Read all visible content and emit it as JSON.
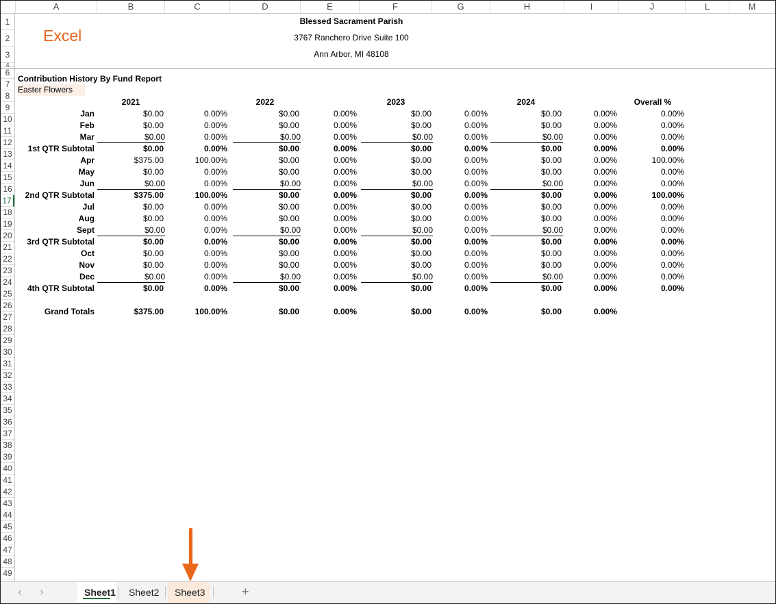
{
  "columns": [
    "A",
    "B",
    "C",
    "D",
    "E",
    "F",
    "G",
    "H",
    "I",
    "J",
    "L",
    "M"
  ],
  "rows": [
    "1",
    "2",
    "3",
    "4",
    "6",
    "7",
    "8",
    "9",
    "10",
    "11",
    "12",
    "13",
    "14",
    "15",
    "16",
    "17",
    "18",
    "19",
    "20",
    "21",
    "22",
    "23",
    "24",
    "25",
    "26",
    "27",
    "28",
    "29",
    "30",
    "31",
    "32",
    "33",
    "34",
    "35",
    "36",
    "37",
    "38",
    "39",
    "40",
    "41",
    "42",
    "43",
    "44",
    "45",
    "46",
    "47",
    "48",
    "49"
  ],
  "logo_text": "Excel",
  "header": {
    "parish": "Blessed Sacrament Parish",
    "address1": "3767 Ranchero Drive Suite 100",
    "address2": "Ann Arbor, MI 48108"
  },
  "report": {
    "title": "Contribution History By Fund Report",
    "fund": "Easter Flowers"
  },
  "years": [
    "2021",
    "2022",
    "2023",
    "2024"
  ],
  "overall_label": "Overall %",
  "table": [
    {
      "label": "Jan",
      "bold": false,
      "ul": false,
      "vals": [
        "$0.00",
        "0.00%",
        "$0.00",
        "0.00%",
        "$0.00",
        "0.00%",
        "$0.00",
        "0.00%",
        "0.00%"
      ]
    },
    {
      "label": "Feb",
      "bold": false,
      "ul": false,
      "vals": [
        "$0.00",
        "0.00%",
        "$0.00",
        "0.00%",
        "$0.00",
        "0.00%",
        "$0.00",
        "0.00%",
        "0.00%"
      ]
    },
    {
      "label": "Mar",
      "bold": false,
      "ul": true,
      "vals": [
        "$0.00",
        "0.00%",
        "$0.00",
        "0.00%",
        "$0.00",
        "0.00%",
        "$0.00",
        "0.00%",
        "0.00%"
      ]
    },
    {
      "label": "1st QTR Subtotal",
      "bold": true,
      "ul": false,
      "vals": [
        "$0.00",
        "0.00%",
        "$0.00",
        "0.00%",
        "$0.00",
        "0.00%",
        "$0.00",
        "0.00%",
        "0.00%"
      ]
    },
    {
      "label": "Apr",
      "bold": false,
      "ul": false,
      "vals": [
        "$375.00",
        "100.00%",
        "$0.00",
        "0.00%",
        "$0.00",
        "0.00%",
        "$0.00",
        "0.00%",
        "100.00%"
      ]
    },
    {
      "label": "May",
      "bold": false,
      "ul": false,
      "vals": [
        "$0.00",
        "0.00%",
        "$0.00",
        "0.00%",
        "$0.00",
        "0.00%",
        "$0.00",
        "0.00%",
        "0.00%"
      ]
    },
    {
      "label": "Jun",
      "bold": false,
      "ul": true,
      "vals": [
        "$0.00",
        "0.00%",
        "$0.00",
        "0.00%",
        "$0.00",
        "0.00%",
        "$0.00",
        "0.00%",
        "0.00%"
      ]
    },
    {
      "label": "2nd QTR Subtotal",
      "bold": true,
      "ul": false,
      "vals": [
        "$375.00",
        "100.00%",
        "$0.00",
        "0.00%",
        "$0.00",
        "0.00%",
        "$0.00",
        "0.00%",
        "100.00%"
      ]
    },
    {
      "label": "Jul",
      "bold": false,
      "ul": false,
      "vals": [
        "$0.00",
        "0.00%",
        "$0.00",
        "0.00%",
        "$0.00",
        "0.00%",
        "$0.00",
        "0.00%",
        "0.00%"
      ]
    },
    {
      "label": "Aug",
      "bold": false,
      "ul": false,
      "vals": [
        "$0.00",
        "0.00%",
        "$0.00",
        "0.00%",
        "$0.00",
        "0.00%",
        "$0.00",
        "0.00%",
        "0.00%"
      ]
    },
    {
      "label": "Sept",
      "bold": false,
      "ul": true,
      "vals": [
        "$0.00",
        "0.00%",
        "$0.00",
        "0.00%",
        "$0.00",
        "0.00%",
        "$0.00",
        "0.00%",
        "0.00%"
      ]
    },
    {
      "label": "3rd QTR Subtotal",
      "bold": true,
      "ul": false,
      "vals": [
        "$0.00",
        "0.00%",
        "$0.00",
        "0.00%",
        "$0.00",
        "0.00%",
        "$0.00",
        "0.00%",
        "0.00%"
      ]
    },
    {
      "label": "Oct",
      "bold": false,
      "ul": false,
      "vals": [
        "$0.00",
        "0.00%",
        "$0.00",
        "0.00%",
        "$0.00",
        "0.00%",
        "$0.00",
        "0.00%",
        "0.00%"
      ]
    },
    {
      "label": "Nov",
      "bold": false,
      "ul": false,
      "vals": [
        "$0.00",
        "0.00%",
        "$0.00",
        "0.00%",
        "$0.00",
        "0.00%",
        "$0.00",
        "0.00%",
        "0.00%"
      ]
    },
    {
      "label": "Dec",
      "bold": false,
      "ul": true,
      "vals": [
        "$0.00",
        "0.00%",
        "$0.00",
        "0.00%",
        "$0.00",
        "0.00%",
        "$0.00",
        "0.00%",
        "0.00%"
      ]
    },
    {
      "label": "4th QTR Subtotal",
      "bold": true,
      "ul": false,
      "vals": [
        "$0.00",
        "0.00%",
        "$0.00",
        "0.00%",
        "$0.00",
        "0.00%",
        "$0.00",
        "0.00%",
        "0.00%"
      ]
    }
  ],
  "grand_totals": {
    "label": "Grand Totals",
    "vals": [
      "$375.00",
      "100.00%",
      "$0.00",
      "0.00%",
      "$0.00",
      "0.00%",
      "$0.00",
      "0.00%"
    ]
  },
  "tabs": [
    {
      "label": "Sheet1",
      "active": true,
      "highlight": false
    },
    {
      "label": "Sheet2",
      "active": false,
      "highlight": false
    },
    {
      "label": "Sheet3",
      "active": false,
      "highlight": true
    }
  ],
  "nav": {
    "prev": "‹",
    "next": "›",
    "add": "+"
  },
  "colors": {
    "accent": "#e8671d",
    "excel_green": "#1e6e3a",
    "highlight": "#fcefe6"
  }
}
